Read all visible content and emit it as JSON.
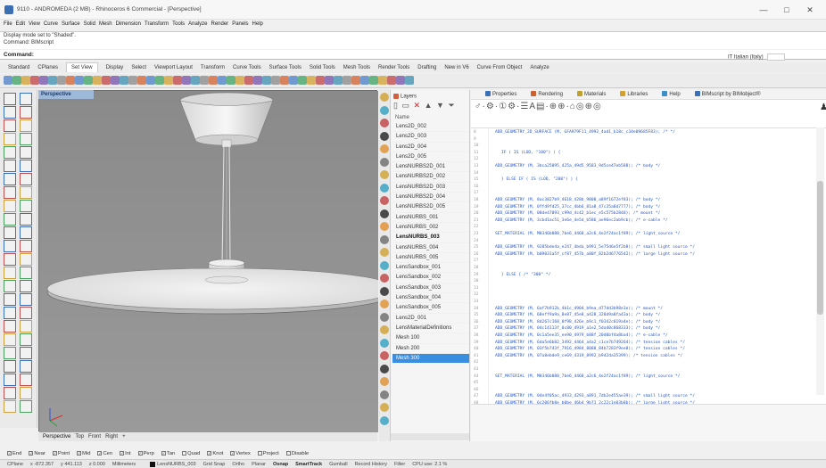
{
  "window": {
    "title": "9110 - ANDROMEDA (2 MB) - Rhinoceros 6 Commercial - [Perspective]",
    "controls": {
      "minimize": "—",
      "maximize": "□",
      "close": "✕"
    }
  },
  "menu": [
    "File",
    "Edit",
    "View",
    "Curve",
    "Surface",
    "Solid",
    "Mesh",
    "Dimension",
    "Transform",
    "Tools",
    "Analyze",
    "Render",
    "Panels",
    "Help"
  ],
  "command": {
    "history": [
      "Display mode set to \"Shaded\".",
      "Command: BIMscript"
    ],
    "prompt": "Command:",
    "units": "IT Italian (Italy)"
  },
  "tabs": [
    "Standard",
    "CPlanes",
    "Set View",
    "Display",
    "Select",
    "Viewport Layout",
    "Transform",
    "Curve Tools",
    "Surface Tools",
    "Solid Tools",
    "Mesh Tools",
    "Render Tools",
    "Drafting",
    "New in V6",
    "Curve From Object",
    "Analyze"
  ],
  "active_tab": "Set View",
  "viewport": {
    "title": "Perspective",
    "tabs": [
      "Perspective",
      "Top",
      "Front",
      "Right",
      "+"
    ]
  },
  "layers": {
    "tab": "Layers",
    "column": "Name",
    "items": [
      "Lens2D_002",
      "Lens2D_003",
      "Lens2D_004",
      "Lens2D_005",
      "LensNURBS2D_001",
      "LensNURBS2D_002",
      "LensNURBS2D_003",
      "LensNURBS2D_004",
      "LensNURBS2D_005",
      "LensNURBS_001",
      "LensNURBS_002",
      "LensNURBS_003",
      "LensNURBS_004",
      "LensNURBS_005",
      "LensSandbox_001",
      "LensSandbox_002",
      "LensSandbox_003",
      "LensSandbox_004",
      "LensSandbox_005",
      "Lens2D_001",
      "LensMaterialDefinitions",
      "Mesh 100",
      "Mesh 200",
      "Mesh 300"
    ],
    "bold_item": "LensNURBS_003",
    "selected_item": "Mesh 300"
  },
  "panel_tabs": [
    "Properties",
    "Rendering",
    "Materials",
    "Libraries",
    "Help",
    "BIMscript by BIMobject®"
  ],
  "code": [
    {
      "ln": "8",
      "text": "ADD_GEOMETRY_2D_SURFACE (M, GFA979F11_4992_4ad1_b18c_c34e09685F83); /* */",
      "t": "call"
    },
    {
      "ln": "9",
      "text": "",
      "t": ""
    },
    {
      "ln": "10",
      "text": "",
      "t": ""
    },
    {
      "ln": "11",
      "text": "IF ( IS (LOD, \"100\") ) {",
      "t": "kw"
    },
    {
      "ln": "12",
      "text": "",
      "t": ""
    },
    {
      "ln": "13",
      "text": "ADD_GEOMETRY (M, 3bca25095_425a_49d5_9583_9d5ce47eb588); /* body */",
      "t": "call"
    },
    {
      "ln": "14",
      "text": "",
      "t": ""
    },
    {
      "ln": "15",
      "text": "} ELSE IF ( IS (LOD, \"200\") ) {",
      "t": "kw"
    },
    {
      "ln": "16",
      "text": "",
      "t": ""
    },
    {
      "ln": "17",
      "text": "",
      "t": ""
    },
    {
      "ln": "18",
      "text": "ADD_GEOMETRY (M, 8ac3827b9_4618_428b_9800_a89f1672ef83); /* body */",
      "t": "call"
    },
    {
      "ln": "19",
      "text": "ADD_GEOMETRY (M, 0ffd9fd25_37cc_4bb6_81a8_47c35a8d7777); /* body */",
      "t": "call"
    },
    {
      "ln": "20",
      "text": "ADD_GEOMETRY (M, 08de47093_c99d_4c42_b1ec_e5c575b2848); /* mount */",
      "t": "call"
    },
    {
      "ln": "21",
      "text": "ADD_GEOMETRY (M, 3cbd1ac51_3e6e_4e5d_b586_ae96ec2ab9cb); /* e-cable */",
      "t": "call"
    },
    {
      "ln": "22",
      "text": "",
      "t": ""
    },
    {
      "ln": "23",
      "text": "SET_MATERIAL (M, M8346b088_7be6_4468_a2c6_4e2f24ac1f89); /* light_source */",
      "t": "call"
    },
    {
      "ln": "24",
      "text": "",
      "t": ""
    },
    {
      "ln": "25",
      "text": "ADD_GEOMETRY (M, 9285bde4a_e247_4bda_b991_5e75d6e5f2b8); /* small light source */",
      "t": "call"
    },
    {
      "ln": "26",
      "text": "ADD_GEOMETRY (M, b09031a5f_cf87_457b_a80f_82b2d6776542); /* large light source */",
      "t": "call"
    },
    {
      "ln": "27",
      "text": "",
      "t": ""
    },
    {
      "ln": "28",
      "text": "",
      "t": ""
    },
    {
      "ln": "29",
      "text": "} ELSE { /* \"300\" */",
      "t": "kw"
    },
    {
      "ln": "30",
      "text": "",
      "t": ""
    },
    {
      "ln": "31",
      "text": "",
      "t": ""
    },
    {
      "ln": "32",
      "text": "",
      "t": ""
    },
    {
      "ln": "33",
      "text": "",
      "t": ""
    },
    {
      "ln": "34",
      "text": "ADD_GEOMETRY (M, 6af7b912b_4b1c_4904_b9ea_d77dd3b98e1e); /* mount */",
      "t": "call"
    },
    {
      "ln": "35",
      "text": "ADD_GEOMETRY (M, 68eff9a9a_8e87_45e8_a428_328d9a8fa43a); /* body */",
      "t": "call"
    },
    {
      "ln": "36",
      "text": "ADD_GEOMETRY (M, 8d267c168_0f98_426e_b9c1_f0342c019a4e); /* body */",
      "t": "call"
    },
    {
      "ln": "37",
      "text": "ADD_GEOMETRY (M, 04c14113f_0c80_4919_a1e2_5da40c868333); /* body */",
      "t": "call"
    },
    {
      "ln": "38",
      "text": "ADD_GEOMETRY (M, 0c1a5ee35_ee90_4979_b88f_20d0bf4a8ba4); /* e-cable */",
      "t": "call"
    },
    {
      "ln": "39",
      "text": "ADD_GEOMETRY (M, 6da5e6b82_3492_4464_a4a2_c1ce7b7d9264); /* tension cables */",
      "t": "call"
    },
    {
      "ln": "40",
      "text": "ADD_GEOMETRY (M, 03f5b743f_7916_4984_8088_84b7283f9ee8); /* tension cables */",
      "t": "call"
    },
    {
      "ln": "41",
      "text": "ADD_GEOMETRY (M, 07a8ebde9_ce69_4319_8992_b942da35399); /* tension cables */",
      "t": "call"
    },
    {
      "ln": "42",
      "text": "",
      "t": ""
    },
    {
      "ln": "43",
      "text": "",
      "t": ""
    },
    {
      "ln": "44",
      "text": "SET_MATERIAL (M, M8346b088_7be6_4468_a2c6_4e2f24ac1f89); /* light_source */",
      "t": "call"
    },
    {
      "ln": "45",
      "text": "",
      "t": ""
    },
    {
      "ln": "46",
      "text": "",
      "t": ""
    },
    {
      "ln": "47",
      "text": "ADD_GEOMETRY (M, 04e4f05ac_4933_4293_a891_7db2e455ae39); /* small light source */",
      "t": "call"
    },
    {
      "ln": "48",
      "text": "ADD_GEOMETRY (M, 6c206fb8e_b0be_46b4_9b71_2c22c1e03b8b); /* large light source */",
      "t": "call"
    }
  ],
  "osnap": [
    {
      "label": "End",
      "on": true
    },
    {
      "label": "Near",
      "on": true
    },
    {
      "label": "Point",
      "on": true
    },
    {
      "label": "Mid",
      "on": true
    },
    {
      "label": "Cen",
      "on": true
    },
    {
      "label": "Int",
      "on": true
    },
    {
      "label": "Perp",
      "on": true
    },
    {
      "label": "Tan",
      "on": true
    },
    {
      "label": "Quad",
      "on": false
    },
    {
      "label": "Knot",
      "on": true
    },
    {
      "label": "Vertex",
      "on": true
    },
    {
      "label": "Project",
      "on": false
    },
    {
      "label": "Disable",
      "on": false
    }
  ],
  "status": {
    "cplane": "CPlane",
    "x": "x -872.357",
    "y": "y 441.113",
    "z": "z 0.000",
    "units": "Millimeters",
    "layer": "LensNURBS_003",
    "toggles": [
      "Grid Snap",
      "Ortho",
      "Planar",
      "Osnap",
      "SmartTrack",
      "Gumball",
      "Record History",
      "Filter",
      "CPU use: 2.1 %"
    ],
    "bold_toggles": [
      "Osnap",
      "SmartTrack"
    ]
  },
  "colors": {
    "selection": "#3a8ee0",
    "viewport_bg": "#8c8c8c",
    "code_blue": "#2a57c2",
    "code_green": "#2a8a2a"
  }
}
